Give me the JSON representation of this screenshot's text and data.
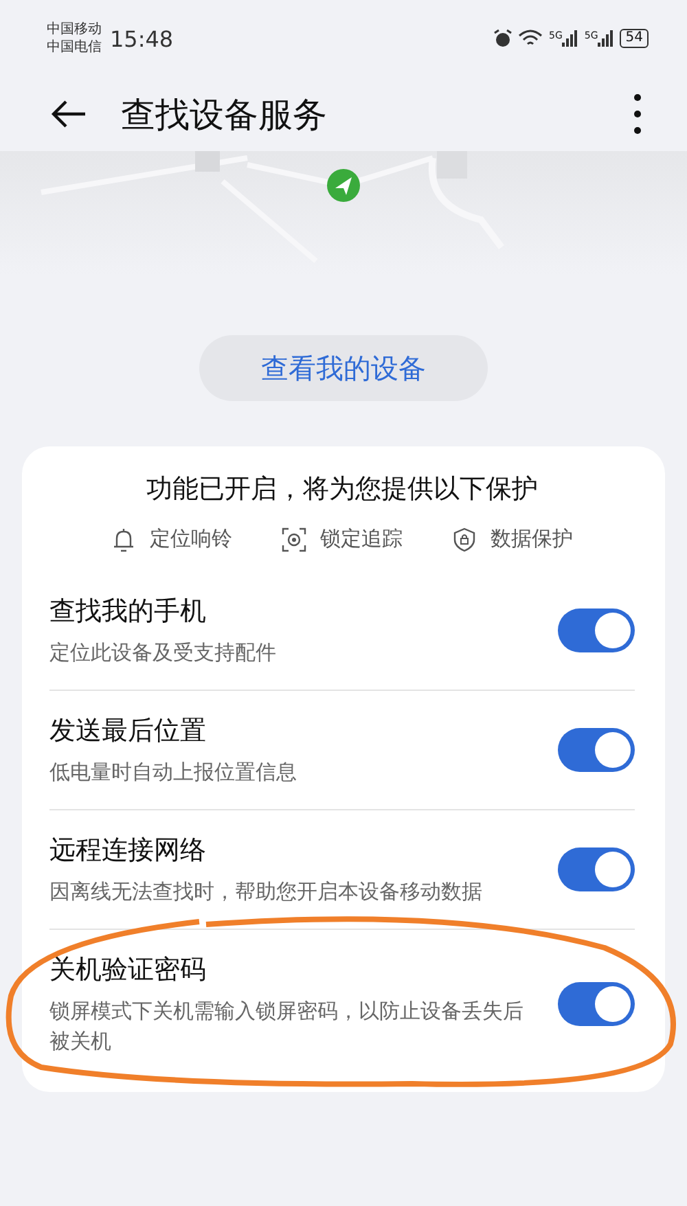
{
  "status_bar": {
    "carriers": [
      "中国移动",
      "中国电信"
    ],
    "time": "15:48",
    "signal_labels": [
      "5G",
      "5G"
    ],
    "battery": "54"
  },
  "header": {
    "title": "查找设备服务"
  },
  "view_button": "查看我的设备",
  "card": {
    "title": "功能已开启，将为您提供以下保护",
    "features": [
      {
        "kind": "bell",
        "label": "定位响铃"
      },
      {
        "kind": "target",
        "label": "锁定追踪"
      },
      {
        "kind": "shield",
        "label": "数据保护"
      }
    ],
    "settings": [
      {
        "title": "查找我的手机",
        "description": "定位此设备及受支持配件",
        "on": true
      },
      {
        "title": "发送最后位置",
        "description": "低电量时自动上报位置信息",
        "on": true
      },
      {
        "title": "远程连接网络",
        "description": "因离线无法查找时，帮助您开启本设备移动数据",
        "on": true
      },
      {
        "title": "关机验证密码",
        "description": "锁屏模式下关机需输入锁屏密码，以防止设备丢失后被关机",
        "on": true,
        "circled": true
      }
    ]
  }
}
